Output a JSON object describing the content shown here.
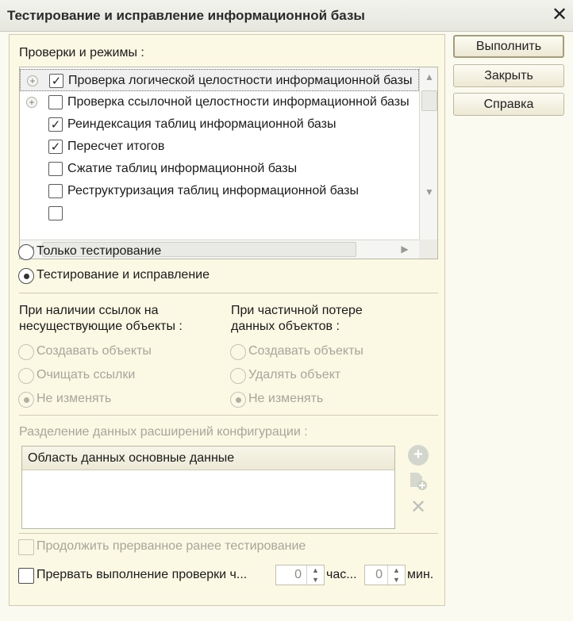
{
  "window": {
    "title": "Тестирование и исправление информационной базы",
    "close_glyph": "✕"
  },
  "checks": {
    "label": "Проверки и режимы :",
    "items": [
      {
        "label": "Проверка логической целостности информационной базы",
        "checked": true,
        "expandable": true
      },
      {
        "label": "Проверка ссылочной целостности информационной базы",
        "checked": false,
        "expandable": true
      },
      {
        "label": "Реиндексация таблиц информационной базы",
        "checked": true,
        "expandable": false
      },
      {
        "label": "Пересчет итогов",
        "checked": true,
        "expandable": false
      },
      {
        "label": "Сжатие таблиц информационной базы",
        "checked": false,
        "expandable": false
      },
      {
        "label": "Реструктуризация таблиц информационной базы",
        "checked": false,
        "expandable": false
      }
    ]
  },
  "mode": {
    "test_only": "Только тестирование",
    "test_and_fix": "Тестирование и исправление",
    "selected": "test_and_fix"
  },
  "missing_refs": {
    "label_line1": "При наличии ссылок на",
    "label_line2": "несуществующие объекты :",
    "options": [
      "Создавать объекты",
      "Очищать ссылки",
      "Не изменять"
    ],
    "selected": 2
  },
  "partial_loss": {
    "label_line1": "При частичной потере",
    "label_line2": "данных объектов :",
    "options": [
      "Создавать объекты",
      "Удалять объект",
      "Не изменять"
    ],
    "selected": 2
  },
  "extensions": {
    "label": "Разделение данных расширений конфигурации :",
    "column_header": "Область данных основные данные"
  },
  "continue_checkbox": {
    "label": "Продолжить прерванное ранее тестирование",
    "checked": false
  },
  "interrupt": {
    "label": "Прервать выполнение проверки ч...",
    "hours_value": "0",
    "hours_unit": "час...",
    "minutes_value": "0",
    "minutes_unit": "мин.",
    "checked": false
  },
  "buttons": {
    "run": "Выполнить",
    "close": "Закрыть",
    "help": "Справка"
  },
  "icons": {
    "expand": "plus-circle-icon",
    "add": "add-circle-icon",
    "add_copy": "add-document-icon",
    "delete": "delete-cross-icon"
  }
}
